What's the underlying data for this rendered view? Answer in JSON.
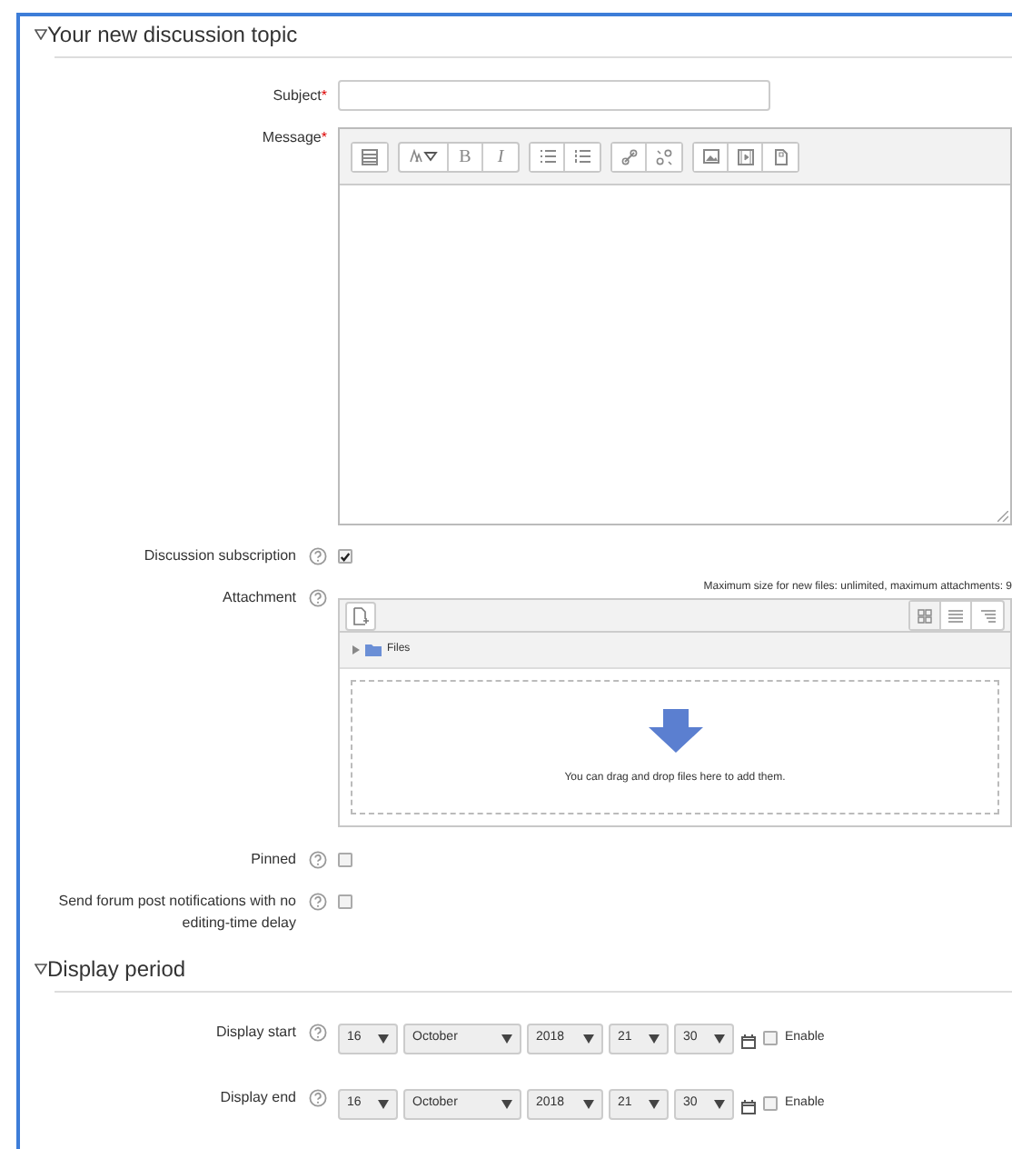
{
  "sections": [
    {
      "title": "Your new discussion topic",
      "expanded": true,
      "fields": [
        {
          "kind": "text",
          "label": "Subject",
          "required_mark": "*",
          "help": false
        },
        {
          "kind": "editor",
          "label": "Message",
          "required_mark": "*",
          "help": false,
          "bold_label": "B",
          "italic_label": "I"
        },
        {
          "kind": "checkbox",
          "label": "Discussion subscription",
          "help": true,
          "checked": true
        },
        {
          "kind": "filepicker",
          "label": "Attachment",
          "help": true,
          "limits": "Maximum size for new files: unlimited, maximum attachments: 9",
          "folder": "Files",
          "drop_hint": "You can drag and drop files here to add them."
        },
        {
          "kind": "checkbox",
          "label": "Pinned",
          "help": true,
          "checked": false
        },
        {
          "kind": "checkbox",
          "label": "Send forum post notifications with no editing-time delay",
          "help": true,
          "checked": false
        }
      ]
    },
    {
      "title": "Display period",
      "expanded": true,
      "fields": [
        {
          "kind": "date",
          "label": "Display start",
          "help": true,
          "selects": [
            "16",
            "October",
            "2018",
            "21",
            "30"
          ],
          "enable_label": "Enable",
          "enabled": false
        },
        {
          "kind": "date",
          "label": "Display end",
          "help": true,
          "selects": [
            "16",
            "October",
            "2018",
            "21",
            "30"
          ],
          "enable_label": "Enable",
          "enabled": false
        }
      ]
    }
  ]
}
